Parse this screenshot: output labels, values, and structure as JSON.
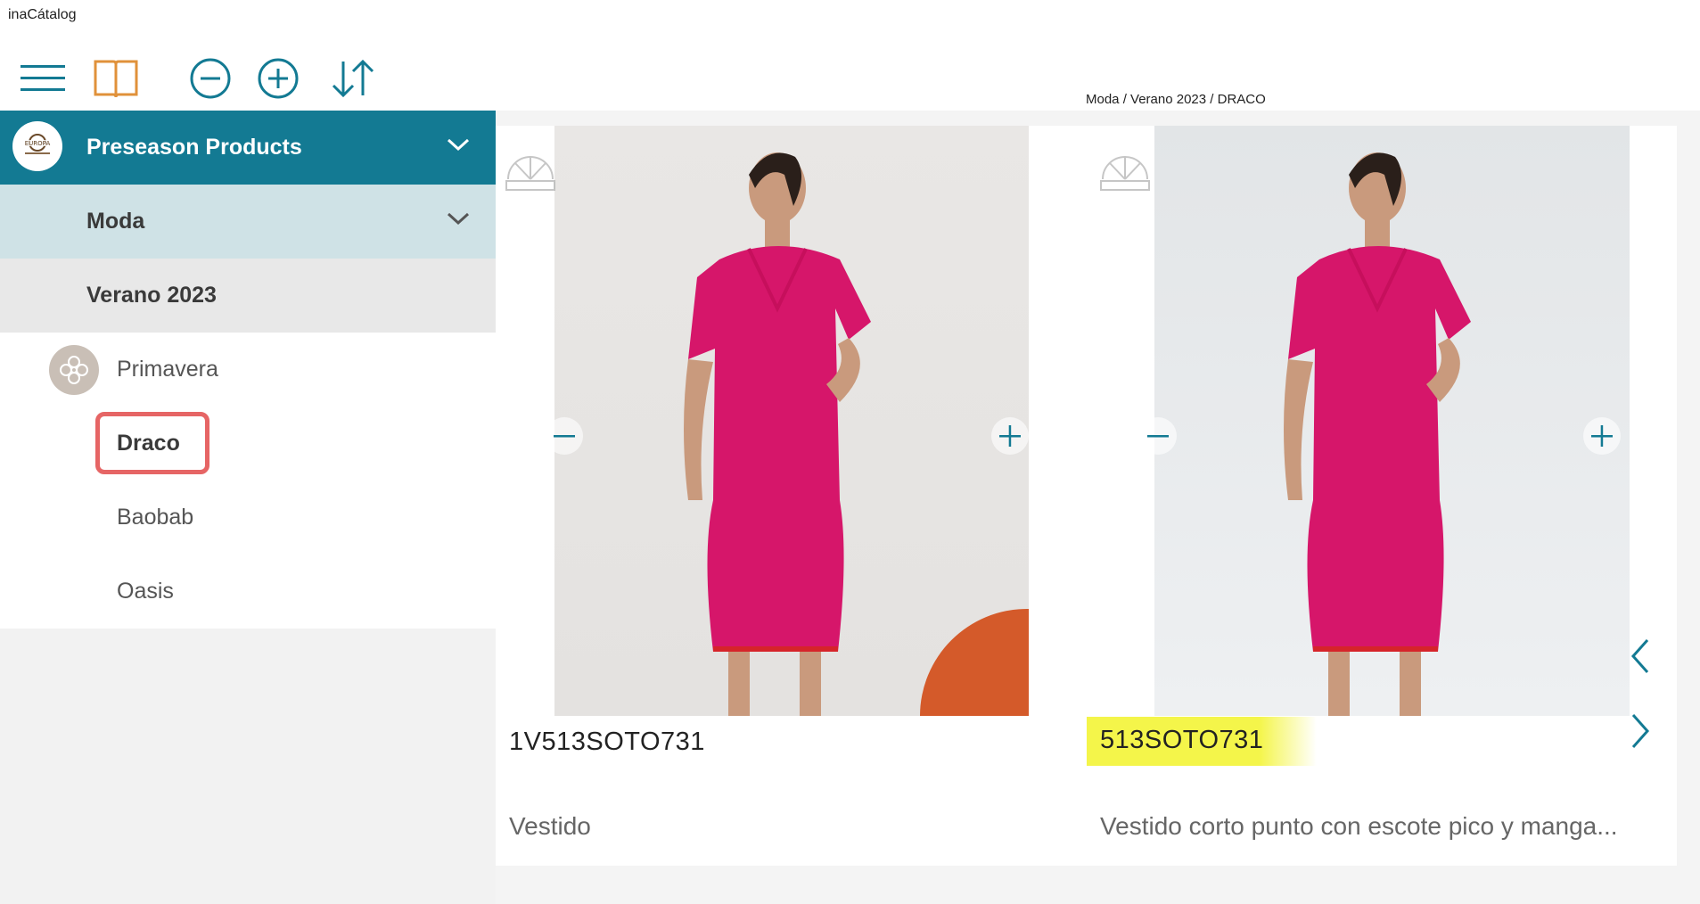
{
  "app": {
    "title": "inaCátalog"
  },
  "toolbar": {
    "icons": [
      "menu-icon",
      "book-icon",
      "zoom-out-icon",
      "zoom-in-icon",
      "sort-icon"
    ]
  },
  "breadcrumb": "Moda / Verano 2023 / DRACO",
  "sidebar": {
    "level1": {
      "label": "Preseason Products"
    },
    "level2": {
      "label": "Moda"
    },
    "level3": {
      "label": "Verano 2023"
    },
    "items": [
      {
        "label": "Primavera"
      },
      {
        "label": "Draco"
      },
      {
        "label": "Baobab"
      },
      {
        "label": "Oasis"
      }
    ]
  },
  "products": [
    {
      "code": "1V513SOTO731",
      "description": "Vestido"
    },
    {
      "code": "513SOTO731",
      "description": "Vestido corto punto con escote pico y manga..."
    }
  ],
  "colors": {
    "accent": "#137a93",
    "level2_bg": "#cfe2e6",
    "highlight": "#f4f54a",
    "selection_border": "#e66565",
    "dress": "#d6166a"
  }
}
